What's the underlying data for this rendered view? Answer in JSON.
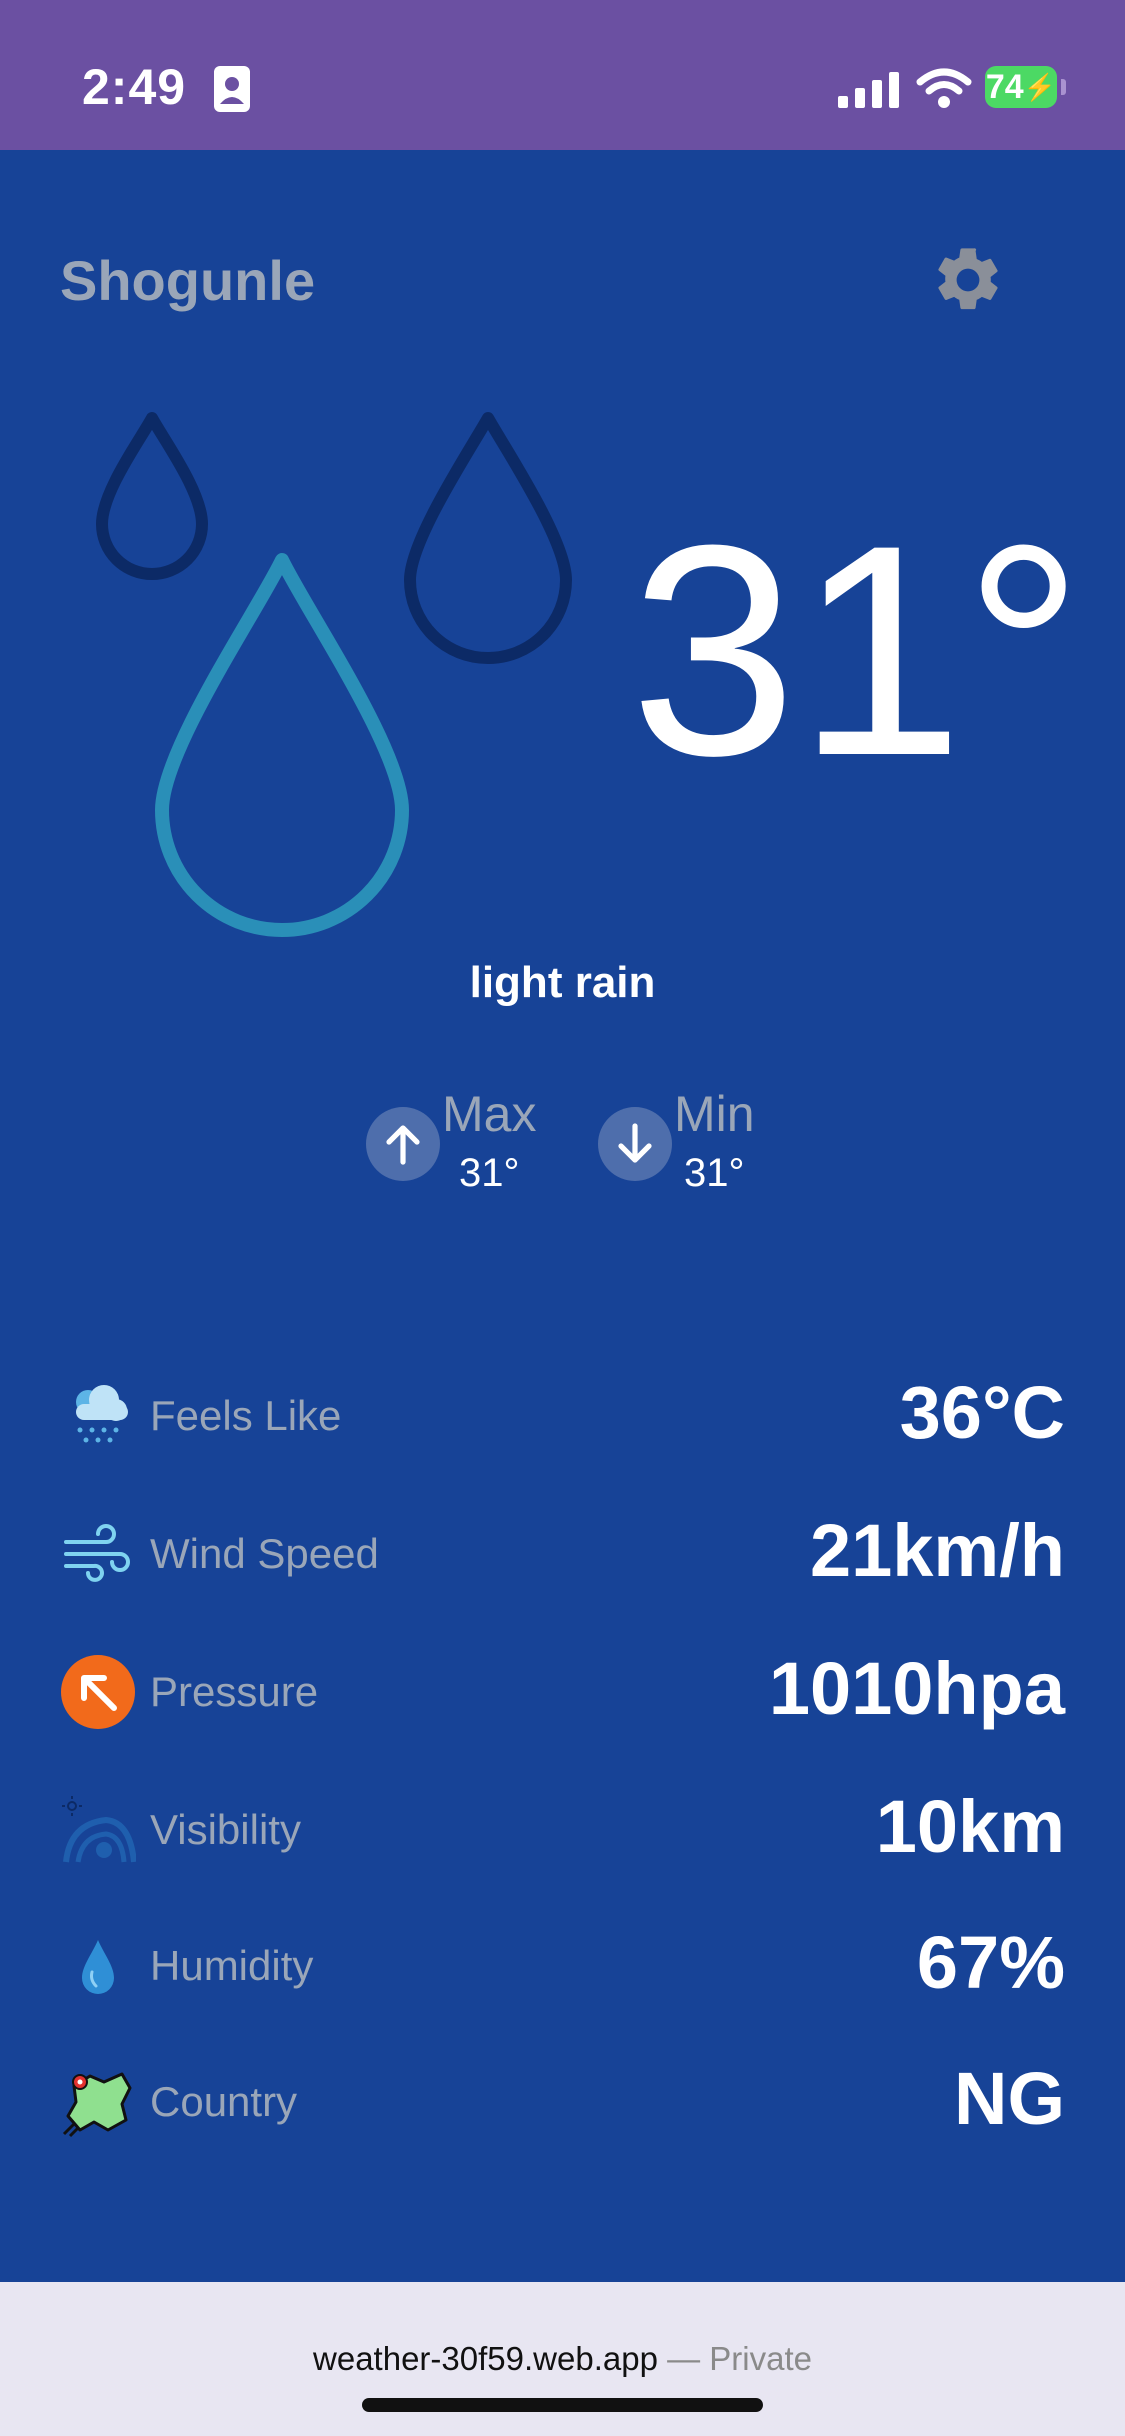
{
  "status_bar": {
    "time": "2:49",
    "battery": "74"
  },
  "header": {
    "city": "Shogunle"
  },
  "current": {
    "temperature": "31°",
    "condition": "light rain",
    "max_label": "Max",
    "max_value": "31°",
    "min_label": "Min",
    "min_value": "31°"
  },
  "details": [
    {
      "label": "Feels Like",
      "value": "36°C",
      "icon": "cloud-rain-icon"
    },
    {
      "label": "Wind Speed",
      "value": "21km/h",
      "icon": "wind-icon"
    },
    {
      "label": "Pressure",
      "value": "1010hpa",
      "icon": "pressure-icon"
    },
    {
      "label": "Visibility",
      "value": "10km",
      "icon": "visibility-icon"
    },
    {
      "label": "Humidity",
      "value": "67%",
      "icon": "water-drop-icon"
    },
    {
      "label": "Country",
      "value": "NG",
      "icon": "map-icon"
    }
  ],
  "browser": {
    "host": "weather-30f59.web.app",
    "mode": "— Private"
  },
  "colors": {
    "background": "#174397",
    "status_bar": "#6b50a2",
    "accent_drop": "#2a8fb8",
    "dark_drop": "#0c2a66"
  }
}
